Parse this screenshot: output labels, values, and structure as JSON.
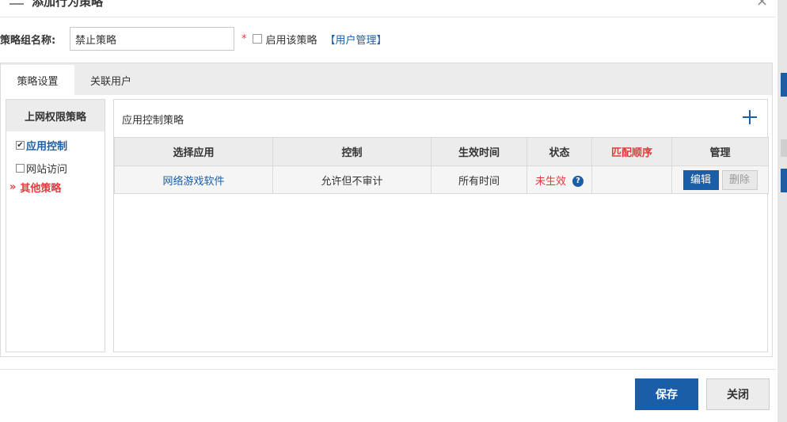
{
  "dialog": {
    "title": "添加行为策略",
    "close_glyph": "×"
  },
  "form": {
    "name_label": "策略组名称:",
    "name_value": "禁止策略",
    "required_mark": "*",
    "enable_label": "启用该策略",
    "user_mgmt_link": "【用户管理】"
  },
  "tabs": [
    {
      "label": "策略设置",
      "active": true
    },
    {
      "label": "关联用户",
      "active": false
    }
  ],
  "left_panel": {
    "header": "上网权限策略",
    "items": [
      {
        "label": "应用控制",
        "checked": true,
        "check_glyph": "✔"
      },
      {
        "label": "网站访问",
        "checked": false
      },
      {
        "label": "其他策略",
        "marker": "»"
      }
    ]
  },
  "right_panel": {
    "title": "应用控制策略",
    "columns": [
      "选择应用",
      "控制",
      "生效时间",
      "状态",
      "匹配顺序",
      "管理"
    ],
    "rows": [
      {
        "app": "网络游戏软件",
        "control": "允许但不审计",
        "time": "所有时间",
        "status": "未生效",
        "help": "?",
        "order": "",
        "edit": "编辑",
        "delete": "删除"
      }
    ]
  },
  "footer": {
    "save_label": "保存",
    "close_label": "关闭"
  },
  "colors": {
    "accent": "#1a5ea8",
    "danger": "#e4393c"
  }
}
